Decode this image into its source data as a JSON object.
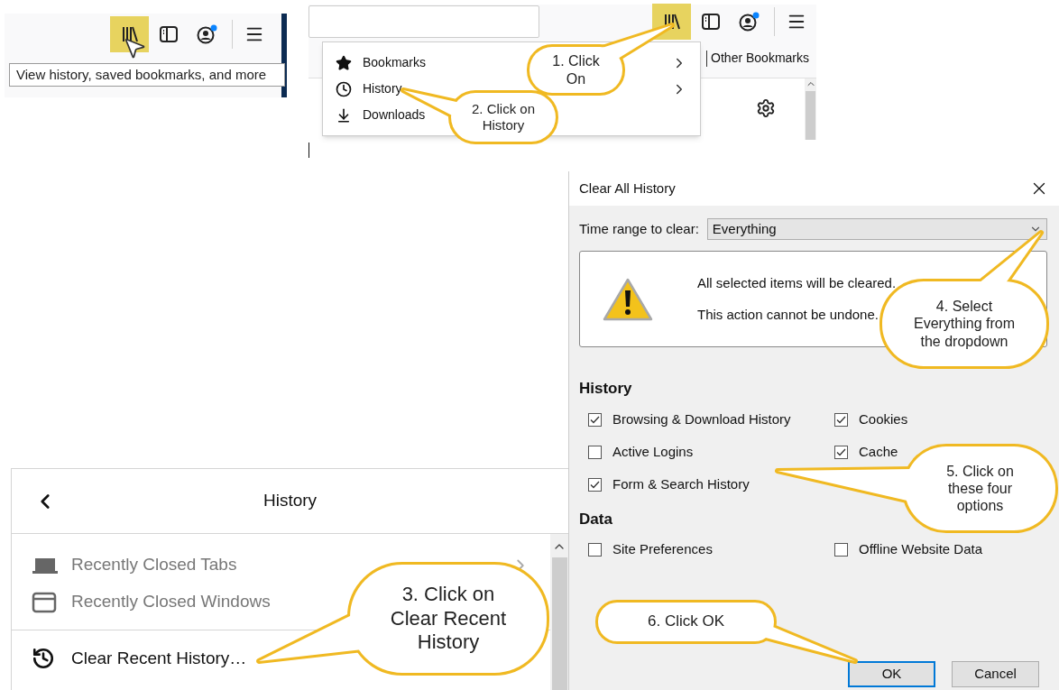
{
  "toolbar_crop": {
    "library_button": {
      "highlighted": true
    },
    "account_badge": true,
    "tooltip": "View history, saved bookmarks, and more"
  },
  "library_menu": {
    "library_button": {
      "highlighted": true
    },
    "account_badge": true,
    "items": [
      {
        "label": "Bookmarks",
        "kind": "star",
        "submenu": true
      },
      {
        "label": "History",
        "kind": "clock",
        "submenu": true
      },
      {
        "label": "Downloads",
        "kind": "download",
        "submenu": false
      }
    ],
    "bookmarks_toolbar": {
      "label": "Other Bookmarks"
    }
  },
  "history_panel": {
    "title": "History",
    "items": [
      {
        "label": "Recently Closed Tabs",
        "kind": "tabs",
        "disabled": true,
        "submenu": true
      },
      {
        "label": "Recently Closed Windows",
        "kind": "windows",
        "disabled": true,
        "submenu": false
      }
    ],
    "clear_item": {
      "label": "Clear Recent History…"
    }
  },
  "dialog": {
    "title": "Clear All History",
    "time_range": {
      "label": "Time range to clear:",
      "value": "Everything"
    },
    "warning": [
      "All selected items will be cleared.",
      "This action cannot be undone."
    ],
    "sections": [
      {
        "title": "History",
        "options": [
          {
            "label": "Browsing & Download History",
            "checked": true
          },
          {
            "label": "Cookies",
            "checked": true
          },
          {
            "label": "Active Logins",
            "checked": false
          },
          {
            "label": "Cache",
            "checked": true
          },
          {
            "label": "Form & Search History",
            "checked": true
          }
        ]
      },
      {
        "title": "Data",
        "options": [
          {
            "label": "Site Preferences",
            "checked": false
          },
          {
            "label": "Offline Website Data",
            "checked": false
          }
        ]
      }
    ],
    "buttons": [
      {
        "label": "OK",
        "default": true
      },
      {
        "label": "Cancel",
        "default": false
      }
    ]
  },
  "callouts": [
    {
      "text": "1. Click\nOn"
    },
    {
      "text": "2. Click on\nHistory"
    },
    {
      "text": "3. Click on\nClear Recent\nHistory"
    },
    {
      "text": "4. Select\nEverything from\nthe dropdown"
    },
    {
      "text": "5. Click on\nthese four\noptions"
    },
    {
      "text": "6. Click OK"
    }
  ]
}
